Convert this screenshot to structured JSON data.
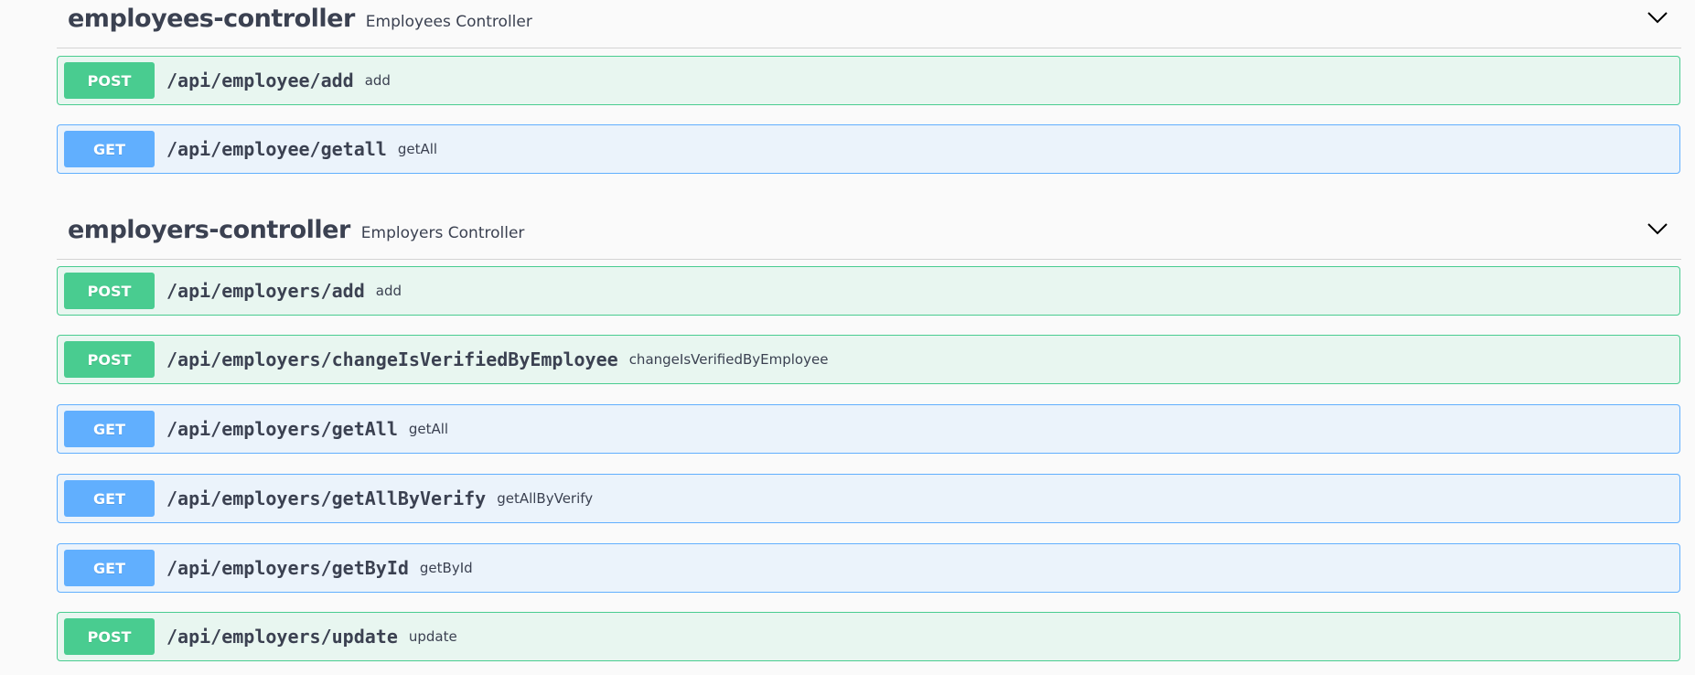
{
  "sections": [
    {
      "name": "employees-controller",
      "description": "Employees Controller",
      "operations": [
        {
          "method": "POST",
          "path": "/api/employee/add",
          "summary": "add"
        },
        {
          "method": "GET",
          "path": "/api/employee/getall",
          "summary": "getAll"
        }
      ]
    },
    {
      "name": "employers-controller",
      "description": "Employers Controller",
      "operations": [
        {
          "method": "POST",
          "path": "/api/employers/add",
          "summary": "add"
        },
        {
          "method": "POST",
          "path": "/api/employers/changeIsVerifiedByEmployee",
          "summary": "changeIsVerifiedByEmployee"
        },
        {
          "method": "GET",
          "path": "/api/employers/getAll",
          "summary": "getAll"
        },
        {
          "method": "GET",
          "path": "/api/employers/getAllByVerify",
          "summary": "getAllByVerify"
        },
        {
          "method": "GET",
          "path": "/api/employers/getById",
          "summary": "getById"
        },
        {
          "method": "POST",
          "path": "/api/employers/update",
          "summary": "update"
        }
      ]
    }
  ],
  "colors": {
    "post": "#49cc90",
    "get": "#61affe",
    "text": "#3b4151"
  },
  "icons": {
    "collapse": "chevron-down-icon"
  }
}
